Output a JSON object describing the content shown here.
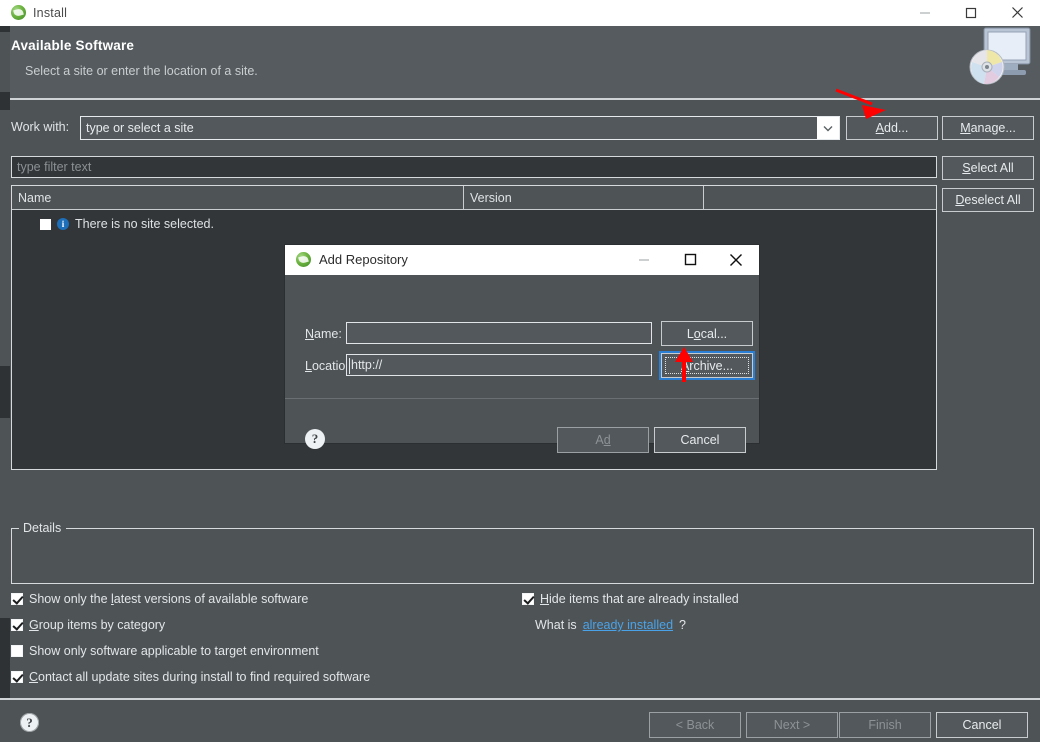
{
  "window": {
    "title": "Install",
    "logo_icon": "eclipse-logo-icon",
    "minimize_icon": "minimize-icon",
    "maximize_icon": "maximize-icon",
    "close_icon": "close-icon"
  },
  "banner": {
    "title": "Available Software",
    "subtitle": "Select a site or enter the location of a site.",
    "art_icon": "monitor-with-cd-icon"
  },
  "work_with": {
    "label": "Work with:",
    "value": "type or select a site",
    "dropdown_icon": "chevron-down-icon",
    "add_button": "Add...",
    "add_button_mnemonic": "A",
    "manage_button": "Manage...",
    "manage_button_mnemonic": "M"
  },
  "filter": {
    "placeholder": "type filter text",
    "select_all_button": "Select All",
    "select_all_mnemonic": "S",
    "deselect_all_button": "Deselect All",
    "deselect_all_mnemonic": "D"
  },
  "table": {
    "columns": [
      "Name",
      "Version",
      ""
    ],
    "rows": [
      {
        "checkbox_checked": false,
        "icon": "info-icon",
        "name": "There is no site selected.",
        "version": ""
      }
    ]
  },
  "details": {
    "legend": "Details",
    "content": ""
  },
  "options": {
    "left": [
      {
        "label": "Show only the latest versions of available software",
        "mnemonic": "l",
        "checked": true
      },
      {
        "label": "Group items by category",
        "mnemonic": "G",
        "checked": true
      },
      {
        "label": "Show only software applicable to target environment",
        "mnemonic": "",
        "checked": false
      },
      {
        "label": "Contact all update sites during install to find required software",
        "mnemonic": "C",
        "checked": true
      }
    ],
    "right": {
      "hide_installed": {
        "label": "Hide items that are already installed",
        "mnemonic": "H",
        "checked": true
      },
      "what_is_prefix": "What is ",
      "what_is_link": "already installed",
      "what_is_suffix": "?"
    }
  },
  "footer": {
    "help_icon": "help-question-icon",
    "buttons": [
      {
        "label": "< Back",
        "enabled": false
      },
      {
        "label": "Next >",
        "enabled": false
      },
      {
        "label": "Finish",
        "enabled": false
      },
      {
        "label": "Cancel",
        "enabled": true
      }
    ]
  },
  "dialog": {
    "title": "Add Repository",
    "logo_icon": "eclipse-logo-icon",
    "minimize_icon": "minimize-icon",
    "maximize_icon": "maximize-icon",
    "close_icon": "close-icon",
    "name_label": "Name:",
    "name_mnemonic": "N",
    "name_value": "",
    "location_label": "Location:",
    "location_mnemonic": "L",
    "location_value": "http://",
    "local_button": "Local...",
    "local_mnemonic": "o",
    "archive_button": "Archive...",
    "archive_mnemonic": "A",
    "archive_focused": true,
    "help_icon": "help-question-icon",
    "add_button": "Add",
    "add_mnemonic": "d",
    "add_enabled": false,
    "cancel_button": "Cancel",
    "cancel_enabled": true
  },
  "annotations": {
    "color": "#ff0000",
    "arrow_to_add_button": "red-arrow-pointing-to-add-button",
    "arrow_to_archive_button": "red-arrow-pointing-to-archive-button"
  }
}
